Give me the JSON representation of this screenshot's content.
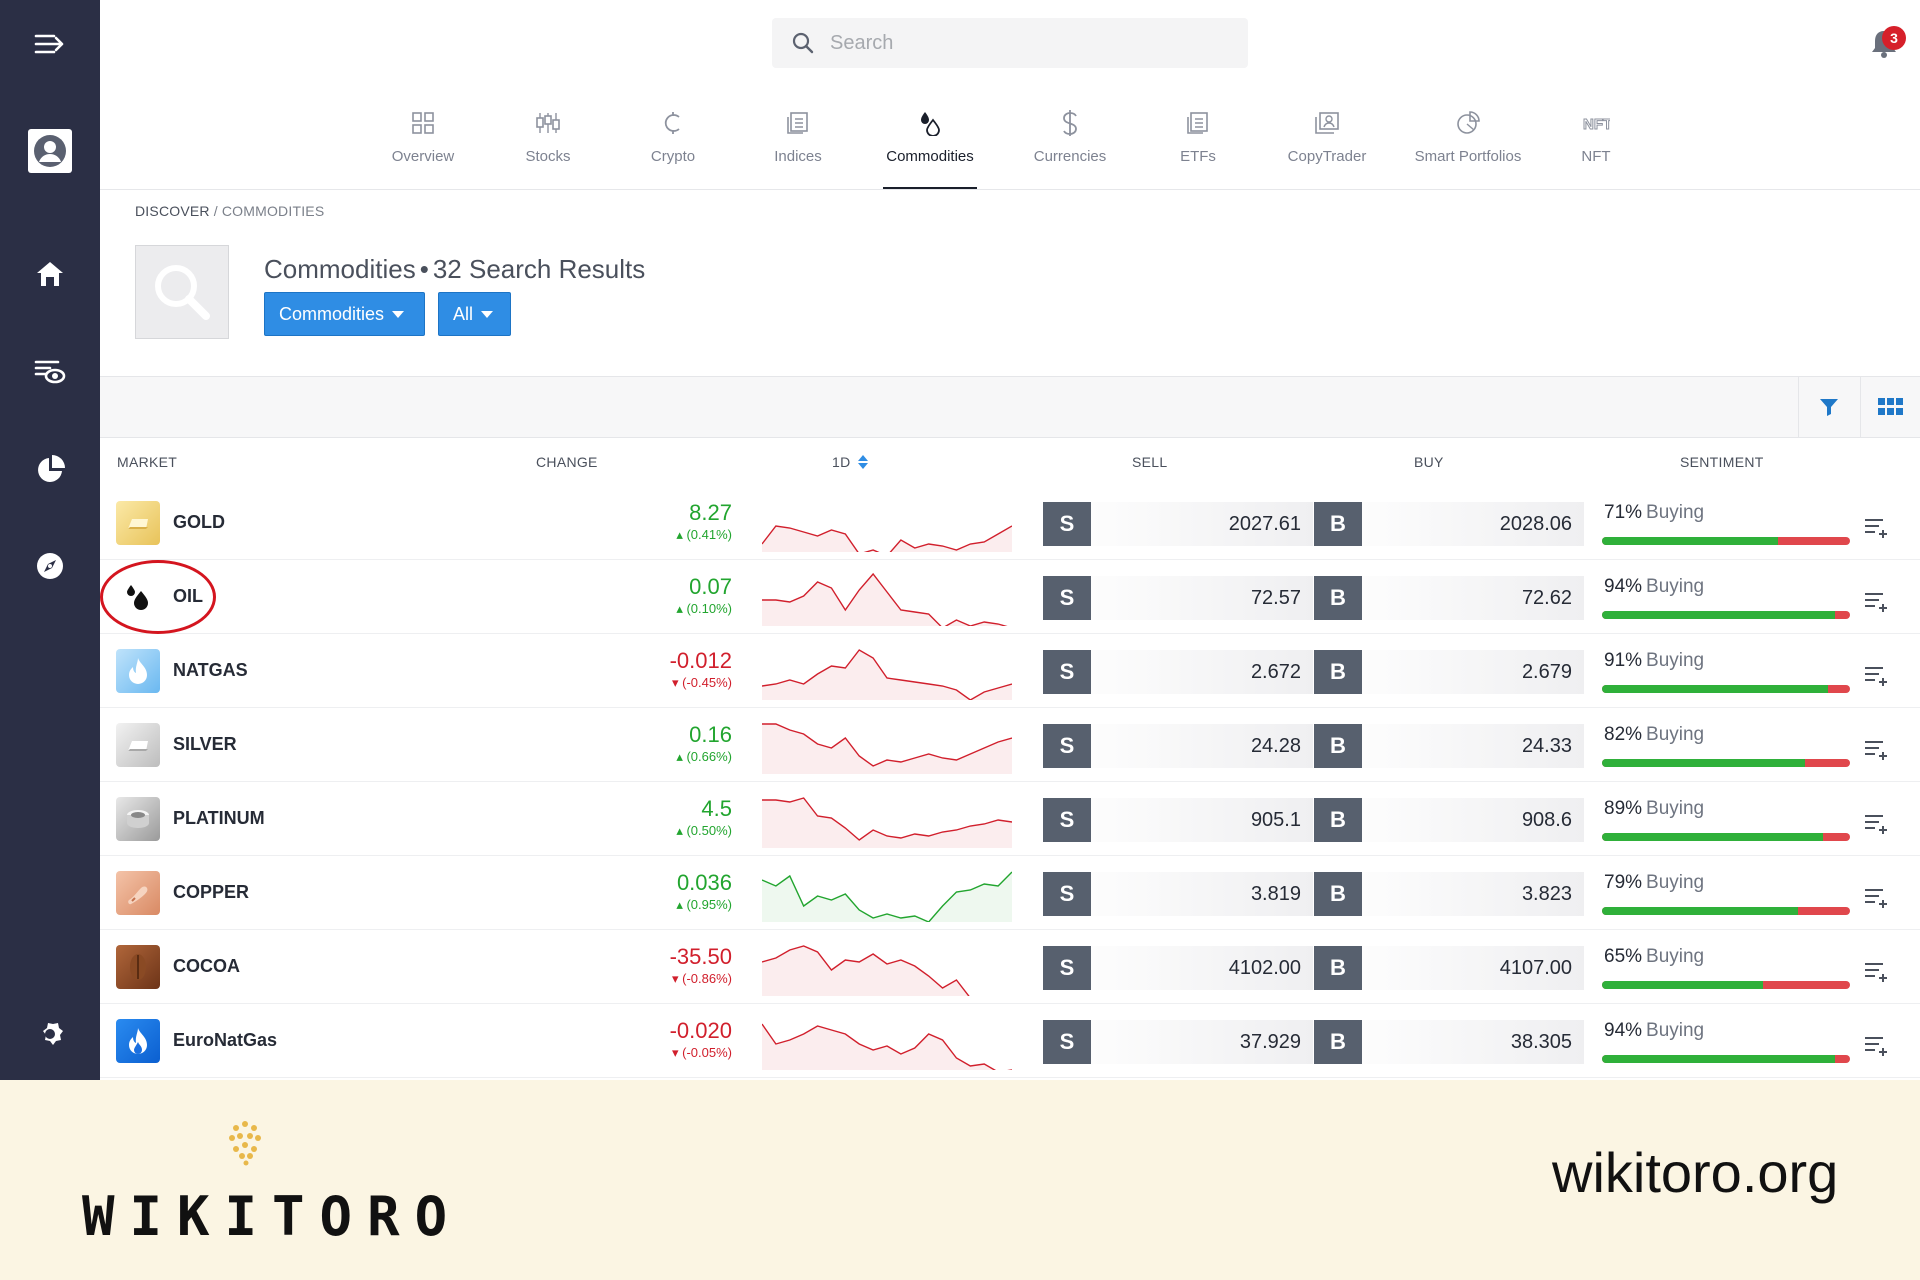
{
  "search": {
    "placeholder": "Search"
  },
  "notifications": {
    "count": "3"
  },
  "tabs": [
    {
      "label": "Overview",
      "icon": "grid-icon"
    },
    {
      "label": "Stocks",
      "icon": "candles-icon"
    },
    {
      "label": "Crypto",
      "icon": "crypto-icon"
    },
    {
      "label": "Indices",
      "icon": "indices-icon"
    },
    {
      "label": "Commodities",
      "icon": "drops-icon",
      "active": true
    },
    {
      "label": "Currencies",
      "icon": "dollar-icon"
    },
    {
      "label": "ETFs",
      "icon": "etf-icon"
    },
    {
      "label": "CopyTrader",
      "icon": "copytrader-icon"
    },
    {
      "label": "Smart Portfolios",
      "icon": "pie-icon"
    },
    {
      "label": "NFT",
      "icon": "nft-icon"
    }
  ],
  "breadcrumb": {
    "root": "DISCOVER",
    "sep": "/",
    "current": "COMMODITIES"
  },
  "header": {
    "title": "Commodities",
    "dot": "•",
    "results": "32 Search Results",
    "filter1": "Commodities",
    "filter2": "All"
  },
  "columns": {
    "market": "MARKET",
    "change": "CHANGE",
    "period": "1D",
    "sell": "SELL",
    "buy": "BUY",
    "sentiment": "SENTIMENT"
  },
  "colors": {
    "positive": "#22a52f",
    "negative": "#d11f2c",
    "accent": "#2f8de4",
    "sidebar": "#2b2f45"
  },
  "rows": [
    {
      "name": "GOLD",
      "icon": "gold-bar-icon",
      "change": "8.27",
      "pct": "(0.41%)",
      "dir": "up",
      "sell": "2027.61",
      "buy": "2028.06",
      "sentiment_pct": "71%",
      "sentiment_label": "Buying",
      "buying_fraction": 0.71,
      "spark": [
        48,
        30,
        32,
        36,
        40,
        34,
        38,
        58,
        54,
        60,
        44,
        52,
        48,
        50,
        54,
        48,
        46,
        38,
        30
      ]
    },
    {
      "name": "OIL",
      "icon": "oil-drops-icon",
      "change": "0.07",
      "pct": "(0.10%)",
      "dir": "up",
      "sell": "72.57",
      "buy": "72.62",
      "sentiment_pct": "94%",
      "sentiment_label": "Buying",
      "buying_fraction": 0.94,
      "spark": [
        30,
        30,
        32,
        26,
        12,
        18,
        40,
        20,
        4,
        22,
        40,
        42,
        44,
        58,
        50,
        56,
        52,
        54,
        58
      ]
    },
    {
      "name": "NATGAS",
      "icon": "flame-icon",
      "change": "-0.012",
      "pct": "(-0.45%)",
      "dir": "down",
      "sell": "2.672",
      "buy": "2.679",
      "sentiment_pct": "91%",
      "sentiment_label": "Buying",
      "buying_fraction": 0.91,
      "spark": [
        42,
        40,
        36,
        40,
        30,
        22,
        24,
        6,
        14,
        34,
        36,
        38,
        40,
        42,
        46,
        56,
        48,
        44,
        40
      ]
    },
    {
      "name": "SILVER",
      "icon": "silver-bar-icon",
      "change": "0.16",
      "pct": "(0.66%)",
      "dir": "up",
      "sell": "24.28",
      "buy": "24.33",
      "sentiment_pct": "82%",
      "sentiment_label": "Buying",
      "buying_fraction": 0.82,
      "spark": [
        6,
        6,
        12,
        16,
        26,
        30,
        20,
        38,
        48,
        42,
        44,
        40,
        36,
        40,
        42,
        36,
        30,
        24,
        20
      ]
    },
    {
      "name": "PLATINUM",
      "icon": "platinum-ring-icon",
      "change": "4.5",
      "pct": "(0.50%)",
      "dir": "up",
      "sell": "905.1",
      "buy": "908.6",
      "sentiment_pct": "89%",
      "sentiment_label": "Buying",
      "buying_fraction": 0.89,
      "spark": [
        8,
        8,
        10,
        6,
        24,
        26,
        36,
        48,
        38,
        44,
        46,
        42,
        44,
        40,
        38,
        34,
        32,
        28,
        30
      ]
    },
    {
      "name": "COPPER",
      "icon": "copper-icon",
      "change": "0.036",
      "pct": "(0.95%)",
      "dir": "up",
      "sell": "3.819",
      "buy": "3.823",
      "sentiment_pct": "79%",
      "sentiment_label": "Buying",
      "buying_fraction": 0.79,
      "spark": [
        14,
        20,
        10,
        40,
        30,
        34,
        28,
        44,
        52,
        48,
        52,
        50,
        56,
        40,
        26,
        24,
        18,
        20,
        6
      ]
    },
    {
      "name": "COCOA",
      "icon": "cocoa-bean-icon",
      "change": "-35.50",
      "pct": "(-0.86%)",
      "dir": "down",
      "sell": "4102.00",
      "buy": "4107.00",
      "sentiment_pct": "65%",
      "sentiment_label": "Buying",
      "buying_fraction": 0.65,
      "spark": [
        22,
        18,
        10,
        6,
        12,
        30,
        20,
        22,
        14,
        24,
        20,
        26,
        36,
        48,
        40,
        58,
        58,
        58,
        58
      ]
    },
    {
      "name": "EuroNatGas",
      "icon": "euro-flame-icon",
      "change": "-0.020",
      "pct": "(-0.05%)",
      "dir": "down",
      "sell": "37.929",
      "buy": "38.305",
      "sentiment_pct": "94%",
      "sentiment_label": "Buying",
      "buying_fraction": 0.94,
      "spark": [
        10,
        30,
        26,
        20,
        12,
        16,
        20,
        30,
        36,
        32,
        40,
        34,
        20,
        26,
        44,
        52,
        50,
        58,
        56
      ]
    }
  ],
  "footer": {
    "brand": "WIKITORO",
    "site": "wikitoro.org"
  }
}
